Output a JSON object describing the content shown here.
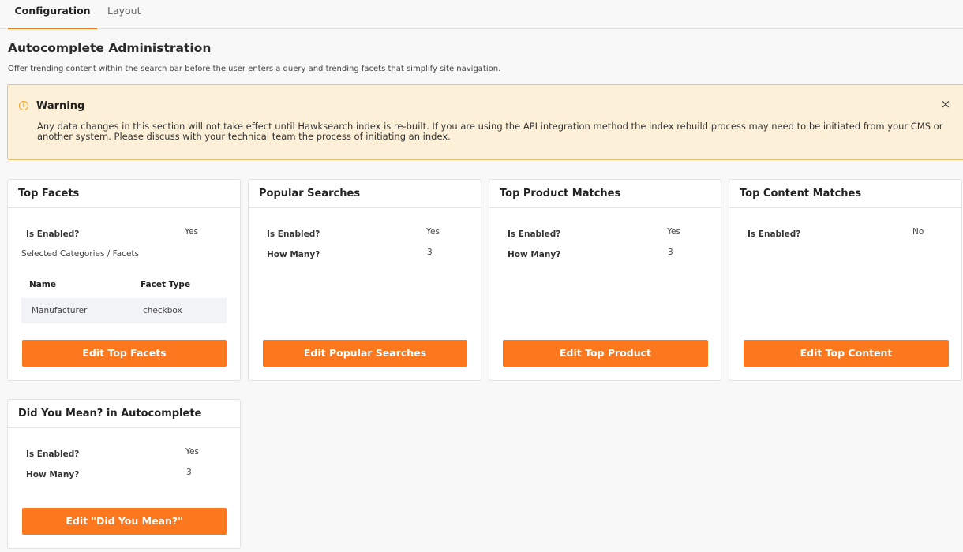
{
  "tabs": [
    {
      "label": "Configuration",
      "active": true
    },
    {
      "label": "Layout",
      "active": false
    }
  ],
  "page": {
    "title": "Autocomplete Administration",
    "description": "Offer trending content within the search bar before the user enters a query and trending facets that simplify site navigation."
  },
  "warning": {
    "title": "Warning",
    "text": "Any data changes in this section will not take effect until Hawksearch index is re-built. If you are using the API integration method the index rebuild process may need to be initiated from your CMS or another system. Please discuss with your technical team the process of initiating an index.",
    "icon": "info-circle-icon",
    "close": "×"
  },
  "cards": {
    "top_facets": {
      "title": "Top Facets",
      "enabled_label": "Is Enabled?",
      "enabled_value": "Yes",
      "selected_label": "Selected Categories / Facets",
      "table": {
        "headers": [
          "Name",
          "Facet Type"
        ],
        "rows": [
          [
            "Manufacturer",
            "checkbox"
          ]
        ]
      },
      "button": "Edit Top Facets"
    },
    "popular_searches": {
      "title": "Popular Searches",
      "enabled_label": "Is Enabled?",
      "enabled_value": "Yes",
      "count_label": "How Many?",
      "count_value": "3",
      "button": "Edit Popular Searches"
    },
    "top_product": {
      "title": "Top Product Matches",
      "enabled_label": "Is Enabled?",
      "enabled_value": "Yes",
      "count_label": "How Many?",
      "count_value": "3",
      "button": "Edit Top Product"
    },
    "top_content": {
      "title": "Top Content Matches",
      "enabled_label": "Is Enabled?",
      "enabled_value": "No",
      "button": "Edit Top Content"
    },
    "did_you_mean": {
      "title": "Did You Mean? in Autocomplete",
      "enabled_label": "Is Enabled?",
      "enabled_value": "Yes",
      "count_label": "How Many?",
      "count_value": "3",
      "button": "Edit \"Did You Mean?\""
    }
  },
  "colors": {
    "accent": "#fc781e",
    "warning_bg": "#fdf0d8",
    "warning_border": "#f1c16e"
  }
}
